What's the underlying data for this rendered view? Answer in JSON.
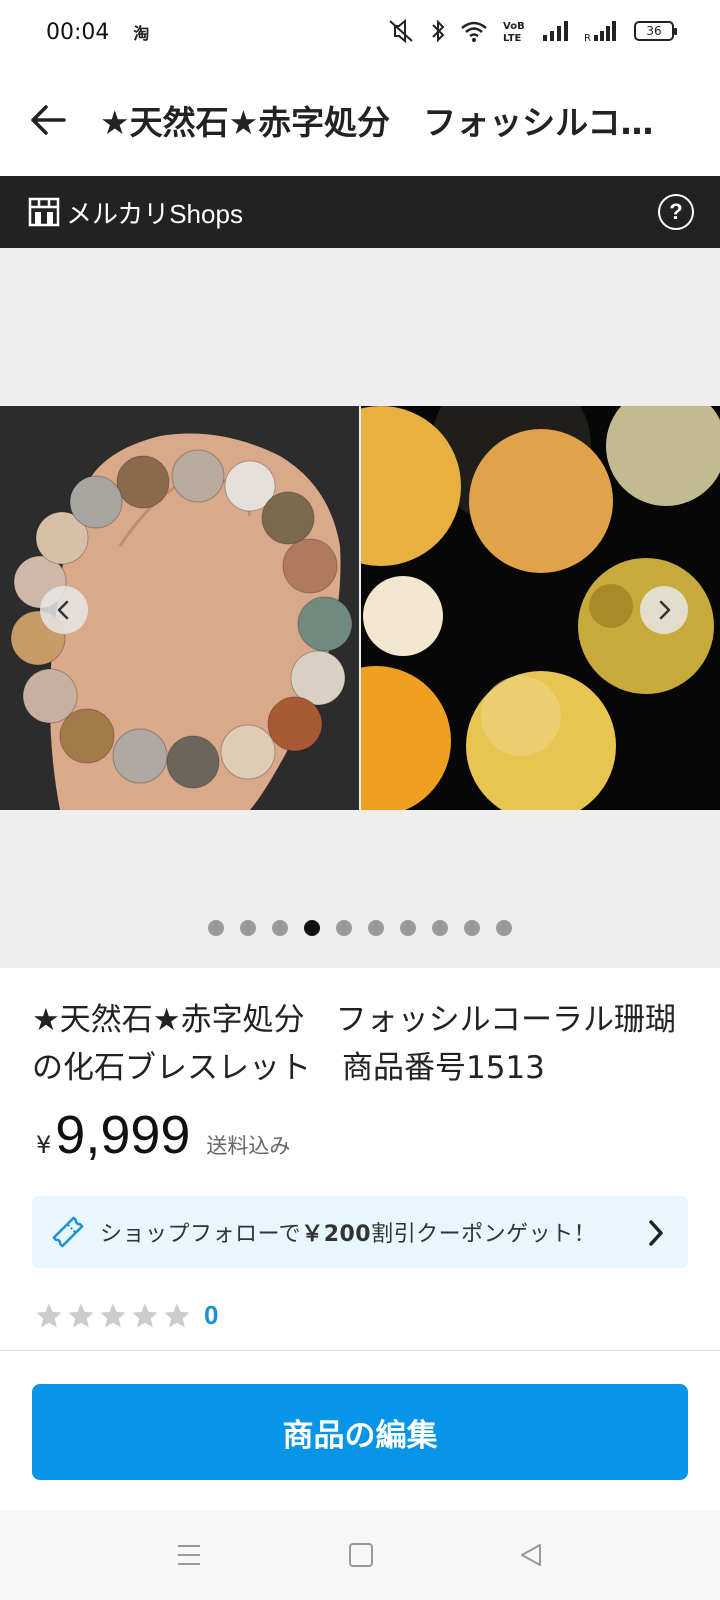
{
  "status_bar": {
    "time": "00:04",
    "carrier_icon": "淘",
    "battery": "36",
    "icons": [
      "mute-icon",
      "bluetooth-icon",
      "wifi-icon",
      "volte-icon",
      "signal-icon",
      "signal-r-icon",
      "battery-icon"
    ]
  },
  "header": {
    "title": "★天然石★赤字処分　フォッシルコーラル珊瑚の化石ブレスレット　商品番号1513",
    "back_icon": "arrow-left-icon"
  },
  "shops_bar": {
    "label": "メルカリShops",
    "help_label": "?"
  },
  "gallery": {
    "dot_count": 10,
    "active_index": 3
  },
  "product": {
    "title": "★天然石★赤字処分　フォッシルコーラル珊瑚の化石ブレスレット　商品番号1513",
    "currency": "¥",
    "price": "9,999",
    "shipping": "送料込み"
  },
  "coupon": {
    "text_before": "ショップフォローで",
    "amount": "￥200",
    "text_after": "割引クーポンゲット！"
  },
  "rating": {
    "stars": 0,
    "max_stars": 5,
    "count": "0"
  },
  "actions": {
    "edit_label": "商品の編集"
  },
  "colors": {
    "primary": "#0895e8",
    "shops_bar": "#222222",
    "coupon_bg": "#e8f6fd",
    "rating_count": "#1f8fd6"
  }
}
